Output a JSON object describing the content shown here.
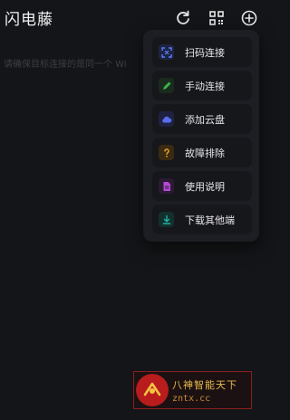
{
  "header": {
    "title": "闪电藤",
    "refresh_icon": "refresh-icon",
    "qr_icon": "qr-code-icon",
    "add_icon": "add-circle-icon"
  },
  "hint": "请确保目标连接的是同一个 Wi",
  "menu": {
    "items": [
      {
        "label": "扫码连接",
        "icon": "scan-icon",
        "color": "#4c6fff"
      },
      {
        "label": "手动连接",
        "icon": "pencil-icon",
        "color": "#3bb54a"
      },
      {
        "label": "添加云盘",
        "icon": "cloud-icon",
        "color": "#5b6cf0"
      },
      {
        "label": "故障排除",
        "icon": "question-icon",
        "color": "#e0a32e"
      },
      {
        "label": "使用说明",
        "icon": "document-icon",
        "color": "#b54ad6"
      },
      {
        "label": "下载其他端",
        "icon": "download-icon",
        "color": "#22b3a8"
      }
    ]
  },
  "watermark": {
    "cn": "八神智能天下",
    "url": "zntx.cc"
  }
}
